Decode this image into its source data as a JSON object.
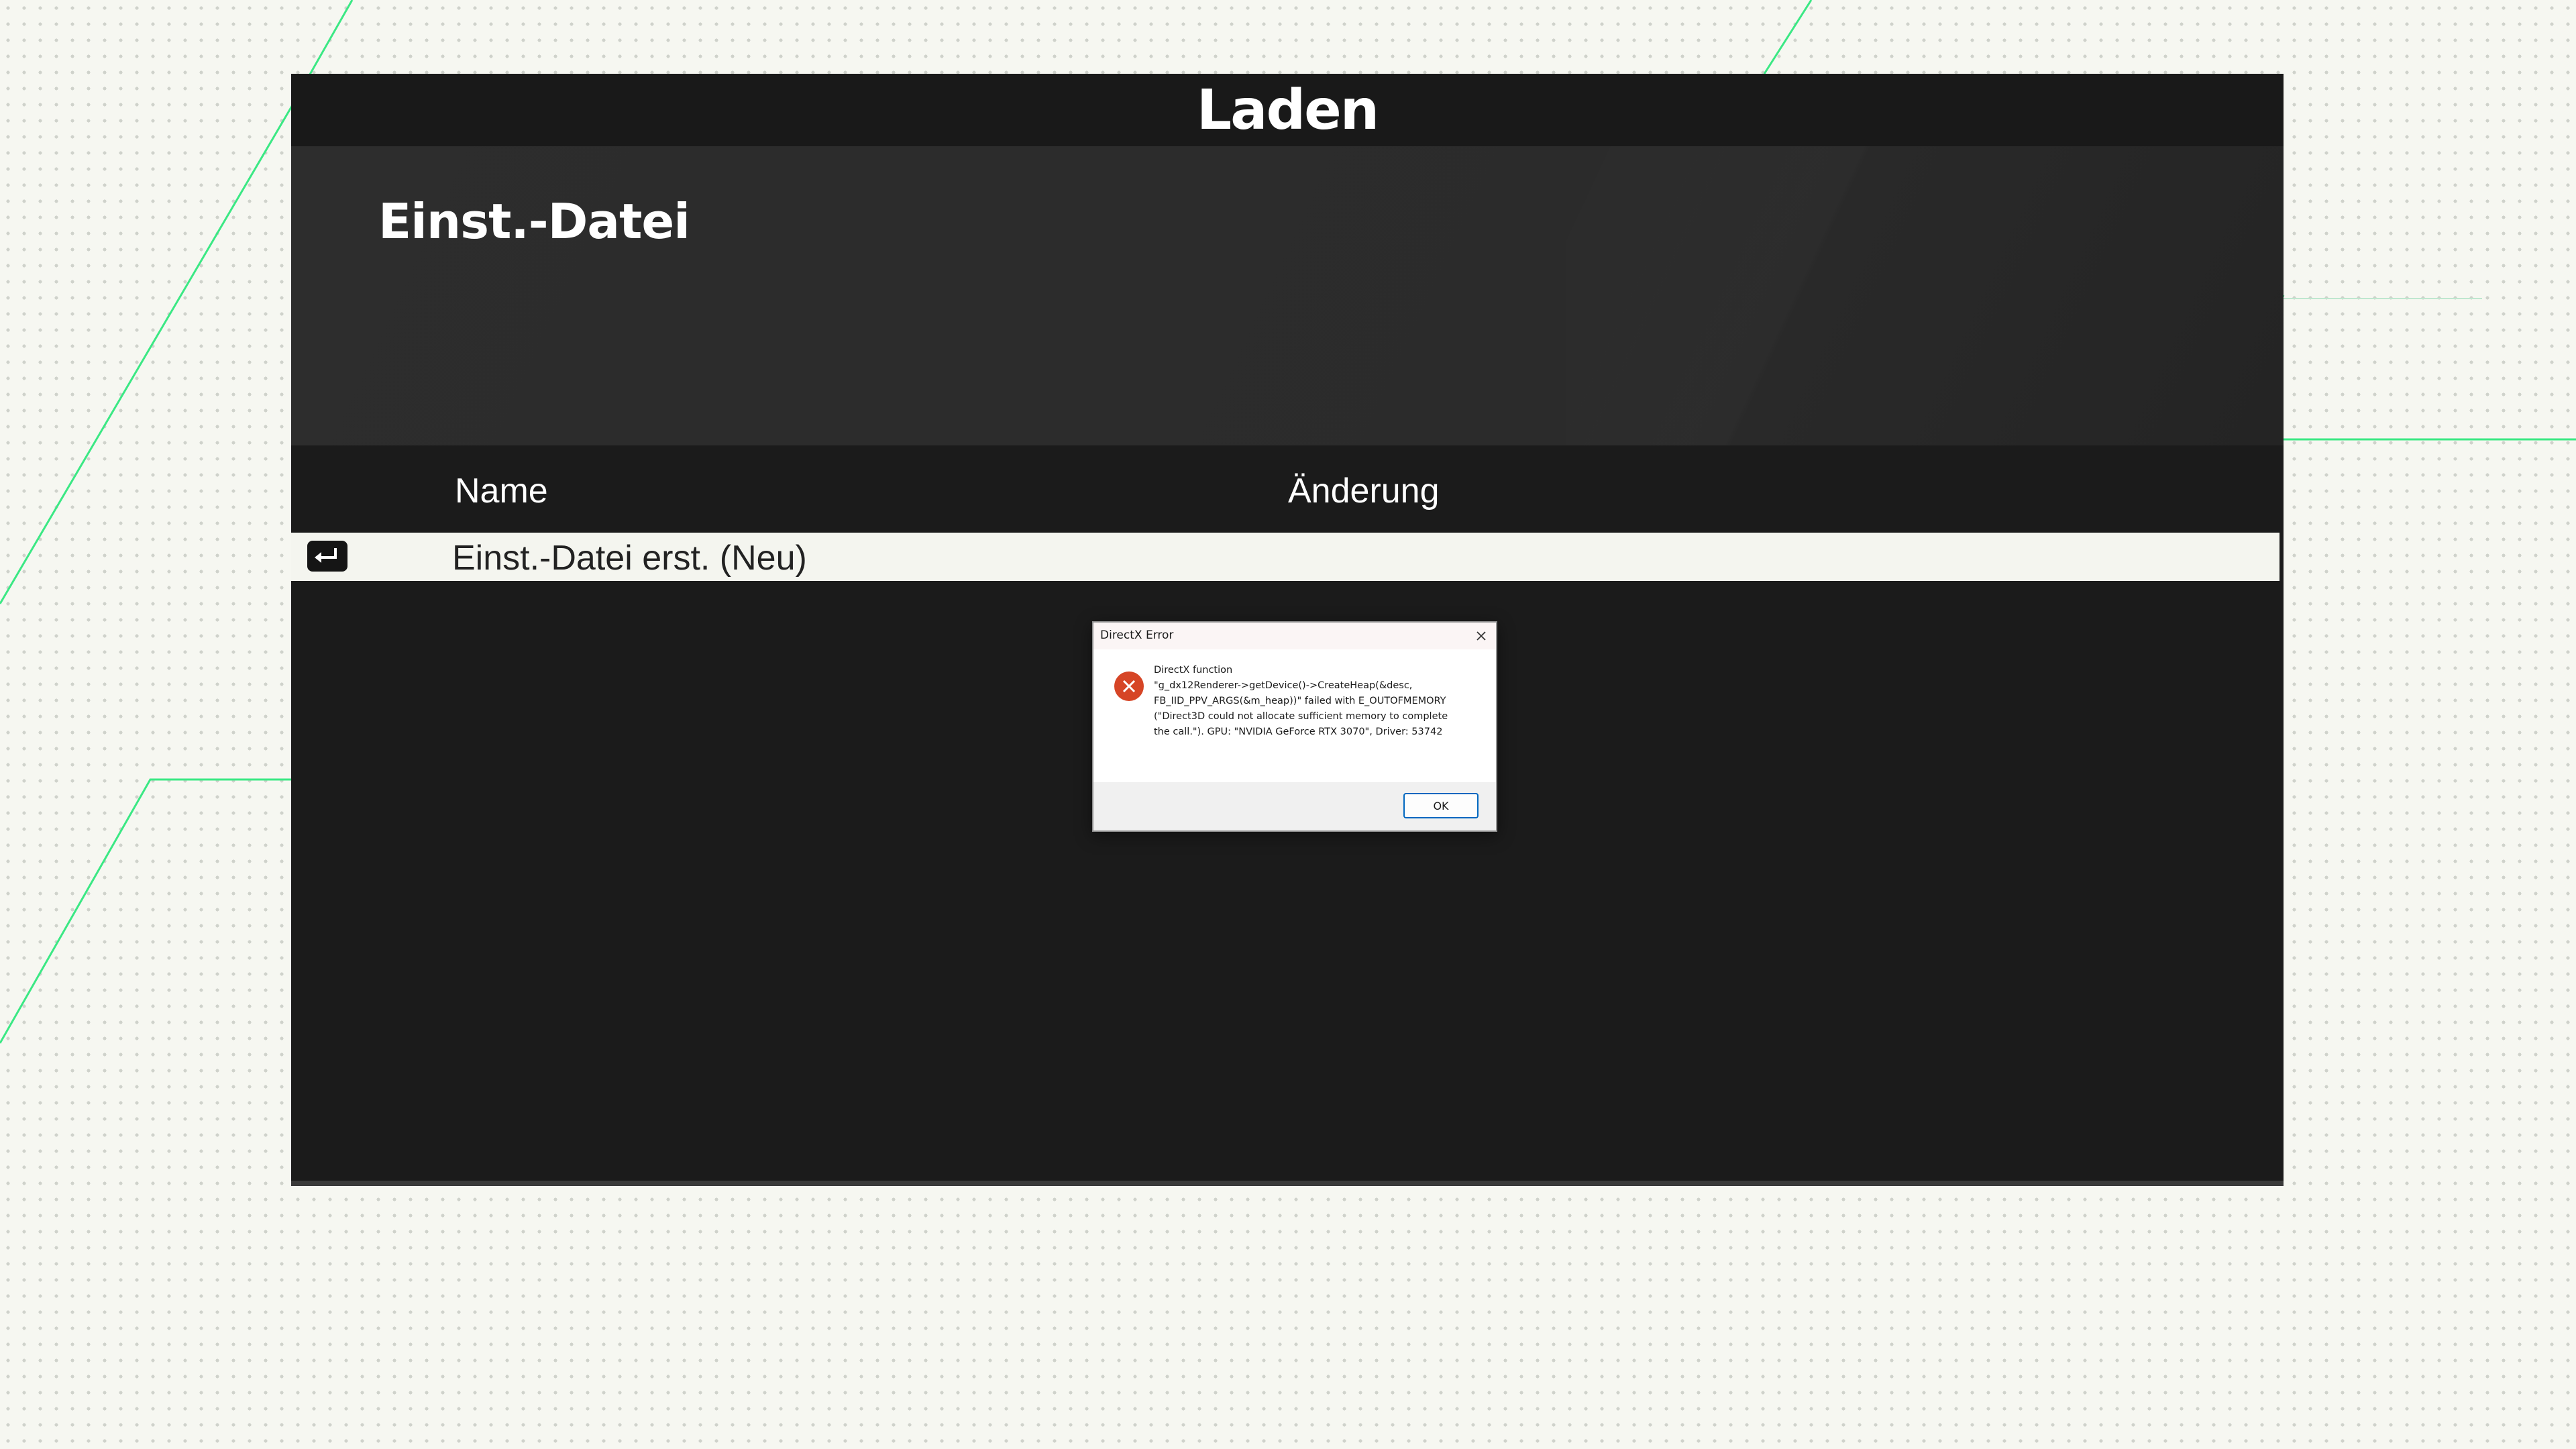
{
  "window": {
    "title": "Laden",
    "section_title": "Einst.-Datei"
  },
  "columns": {
    "name": "Name",
    "change": "Änderung"
  },
  "rows": [
    {
      "label": "Einst.-Datei erst. (Neu)",
      "icon": "enter-key-icon"
    }
  ],
  "dialog": {
    "title": "DirectX Error",
    "message_lines": [
      "DirectX function",
      "\"g_dx12Renderer->getDevice()->CreateHeap(&desc,",
      "FB_IID_PPV_ARGS(&m_heap))\" failed with E_OUTOFMEMORY",
      "(\"Direct3D could not allocate sufficient memory to complete",
      "the call.\"). GPU: \"NVIDIA GeForce RTX 3070\", Driver: 53742"
    ],
    "ok_label": "OK",
    "icon": "error-icon"
  },
  "colors": {
    "accent_green": "#2ee87a",
    "panel_dark": "#1b1b1b",
    "error_red": "#d64526",
    "button_border": "#0067c0"
  }
}
